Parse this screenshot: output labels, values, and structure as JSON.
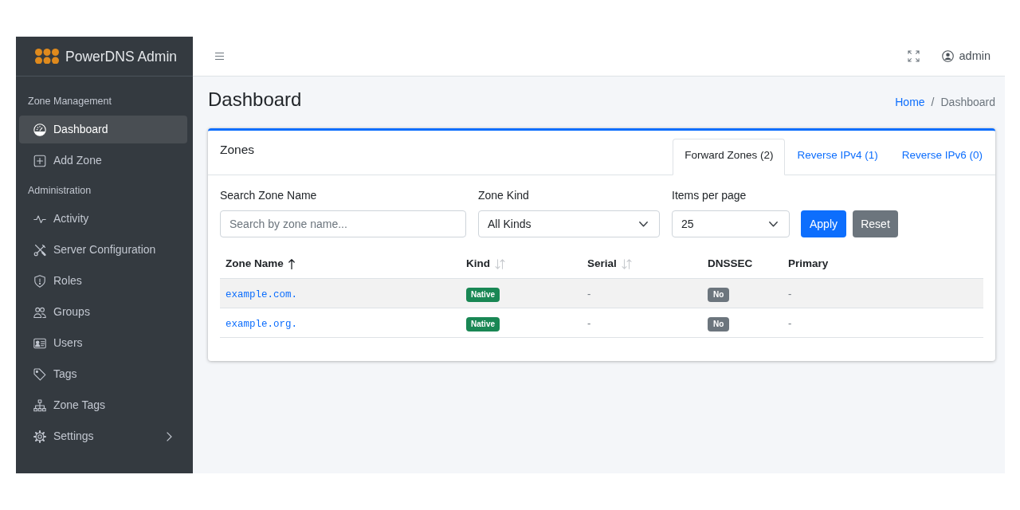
{
  "sidebar": {
    "brand": "PowerDNS Admin",
    "sections": [
      {
        "heading": "Zone Management",
        "items": [
          {
            "label": "Dashboard",
            "kind": "link",
            "selected": true
          },
          {
            "label": "Add Zone",
            "kind": "link",
            "selected": false
          }
        ]
      },
      {
        "heading": "Administration",
        "items": [
          {
            "label": "Activity",
            "kind": "link",
            "selected": false
          },
          {
            "label": "Server Configuration",
            "kind": "link",
            "selected": false
          },
          {
            "label": "Roles",
            "kind": "link",
            "selected": false
          },
          {
            "label": "Groups",
            "kind": "link",
            "selected": false
          },
          {
            "label": "Users",
            "kind": "link",
            "selected": false
          },
          {
            "label": "Tags",
            "kind": "link",
            "selected": false
          },
          {
            "label": "Zone Tags",
            "kind": "link",
            "selected": false
          },
          {
            "label": "Settings",
            "kind": "submenu",
            "selected": false
          }
        ]
      }
    ]
  },
  "navbar": {
    "user": "admin"
  },
  "page": {
    "title": "Dashboard",
    "breadcrumb": {
      "separator": "/",
      "items": [
        {
          "label": "Home",
          "kind": "link"
        },
        {
          "label": "Dashboard",
          "kind": "current"
        }
      ]
    }
  },
  "zones_card": {
    "title": "Zones",
    "tabs": [
      {
        "label": "Forward Zones (2)",
        "selected": true
      },
      {
        "label": "Reverse IPv4 (1)",
        "selected": false
      },
      {
        "label": "Reverse IPv6 (0)",
        "selected": false
      }
    ],
    "filters": [
      {
        "label": "Search Zone Name",
        "kind": "text",
        "placeholder": "Search by zone name..."
      },
      {
        "label": "Zone Kind",
        "kind": "select",
        "value": "All Kinds"
      },
      {
        "label": "Items per page",
        "kind": "select",
        "value": "25"
      }
    ],
    "buttons": [
      {
        "label": "Apply",
        "kind": "apply"
      },
      {
        "label": "Reset",
        "kind": "reset"
      }
    ],
    "table": {
      "columns": [
        {
          "label": "Zone Name",
          "kind": "sortable",
          "sorted": true
        },
        {
          "label": "Kind",
          "kind": "sortable",
          "sorted": false
        },
        {
          "label": "Serial",
          "kind": "sortable",
          "sorted": false
        },
        {
          "label": "DNSSEC",
          "kind": "plain"
        },
        {
          "label": "Primary",
          "kind": "plain"
        }
      ],
      "rows": [
        {
          "cells": [
            "example.com.",
            "Native",
            "-",
            "No",
            "-"
          ]
        },
        {
          "cells": [
            "example.org.",
            "Native",
            "-",
            "No",
            "-"
          ]
        }
      ]
    }
  }
}
